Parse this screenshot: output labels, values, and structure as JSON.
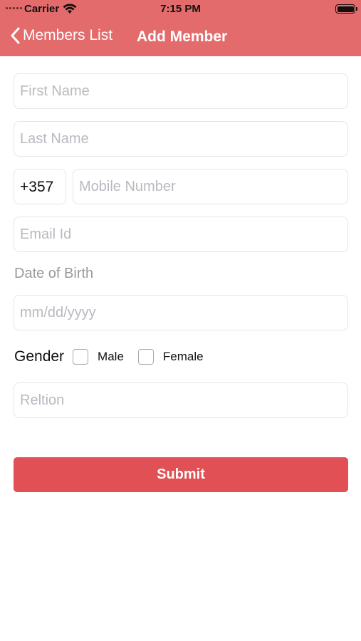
{
  "status_bar": {
    "carrier": "Carrier",
    "time": "7:15 PM",
    "icons": [
      "signal-dots-icon",
      "wifi-icon",
      "battery-icon"
    ]
  },
  "nav": {
    "back_label": "Members List",
    "title": "Add Member",
    "back_icon": "chevron-left-icon"
  },
  "form": {
    "first_name_placeholder": "First Name",
    "last_name_placeholder": "Last Name",
    "country_code": "+357",
    "mobile_placeholder": "Mobile Number",
    "email_placeholder": "Email Id",
    "dob_label": "Date of Birth",
    "dob_placeholder": "mm/dd/yyyy",
    "gender_label": "Gender",
    "gender_options": [
      "Male",
      "Female"
    ],
    "relation_placeholder": "Reltion",
    "submit_label": "Submit"
  },
  "colors": {
    "header": "#e46b6b",
    "submit": "#e05055",
    "placeholder": "#b9b9c0"
  }
}
